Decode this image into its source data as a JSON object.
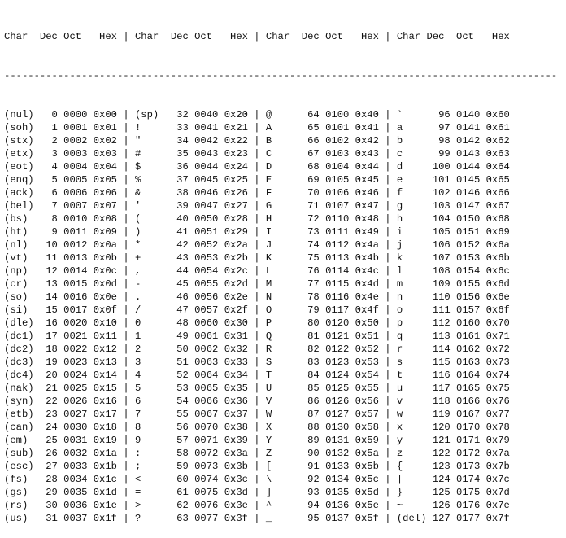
{
  "header": {
    "columns": [
      "Char",
      "Dec",
      "Oct",
      "Hex"
    ],
    "separator": "|",
    "rule": "---------------------------------------------------------------------------------------------"
  },
  "rows": [
    [
      "(nul)",
      "0",
      "0000",
      "0x00",
      "(sp)",
      "32",
      "0040",
      "0x20",
      "@",
      "64",
      "0100",
      "0x40",
      "`",
      "96",
      "0140",
      "0x60"
    ],
    [
      "(soh)",
      "1",
      "0001",
      "0x01",
      "!",
      "33",
      "0041",
      "0x21",
      "A",
      "65",
      "0101",
      "0x41",
      "a",
      "97",
      "0141",
      "0x61"
    ],
    [
      "(stx)",
      "2",
      "0002",
      "0x02",
      "\"",
      "34",
      "0042",
      "0x22",
      "B",
      "66",
      "0102",
      "0x42",
      "b",
      "98",
      "0142",
      "0x62"
    ],
    [
      "(etx)",
      "3",
      "0003",
      "0x03",
      "#",
      "35",
      "0043",
      "0x23",
      "C",
      "67",
      "0103",
      "0x43",
      "c",
      "99",
      "0143",
      "0x63"
    ],
    [
      "(eot)",
      "4",
      "0004",
      "0x04",
      "$",
      "36",
      "0044",
      "0x24",
      "D",
      "68",
      "0104",
      "0x44",
      "d",
      "100",
      "0144",
      "0x64"
    ],
    [
      "(enq)",
      "5",
      "0005",
      "0x05",
      "%",
      "37",
      "0045",
      "0x25",
      "E",
      "69",
      "0105",
      "0x45",
      "e",
      "101",
      "0145",
      "0x65"
    ],
    [
      "(ack)",
      "6",
      "0006",
      "0x06",
      "&",
      "38",
      "0046",
      "0x26",
      "F",
      "70",
      "0106",
      "0x46",
      "f",
      "102",
      "0146",
      "0x66"
    ],
    [
      "(bel)",
      "7",
      "0007",
      "0x07",
      "'",
      "39",
      "0047",
      "0x27",
      "G",
      "71",
      "0107",
      "0x47",
      "g",
      "103",
      "0147",
      "0x67"
    ],
    [
      "(bs)",
      "8",
      "0010",
      "0x08",
      "(",
      "40",
      "0050",
      "0x28",
      "H",
      "72",
      "0110",
      "0x48",
      "h",
      "104",
      "0150",
      "0x68"
    ],
    [
      "(ht)",
      "9",
      "0011",
      "0x09",
      ")",
      "41",
      "0051",
      "0x29",
      "I",
      "73",
      "0111",
      "0x49",
      "i",
      "105",
      "0151",
      "0x69"
    ],
    [
      "(nl)",
      "10",
      "0012",
      "0x0a",
      "*",
      "42",
      "0052",
      "0x2a",
      "J",
      "74",
      "0112",
      "0x4a",
      "j",
      "106",
      "0152",
      "0x6a"
    ],
    [
      "(vt)",
      "11",
      "0013",
      "0x0b",
      "+",
      "43",
      "0053",
      "0x2b",
      "K",
      "75",
      "0113",
      "0x4b",
      "k",
      "107",
      "0153",
      "0x6b"
    ],
    [
      "(np)",
      "12",
      "0014",
      "0x0c",
      ",",
      "44",
      "0054",
      "0x2c",
      "L",
      "76",
      "0114",
      "0x4c",
      "l",
      "108",
      "0154",
      "0x6c"
    ],
    [
      "(cr)",
      "13",
      "0015",
      "0x0d",
      "-",
      "45",
      "0055",
      "0x2d",
      "M",
      "77",
      "0115",
      "0x4d",
      "m",
      "109",
      "0155",
      "0x6d"
    ],
    [
      "(so)",
      "14",
      "0016",
      "0x0e",
      ".",
      "46",
      "0056",
      "0x2e",
      "N",
      "78",
      "0116",
      "0x4e",
      "n",
      "110",
      "0156",
      "0x6e"
    ],
    [
      "(si)",
      "15",
      "0017",
      "0x0f",
      "/",
      "47",
      "0057",
      "0x2f",
      "O",
      "79",
      "0117",
      "0x4f",
      "o",
      "111",
      "0157",
      "0x6f"
    ],
    [
      "(dle)",
      "16",
      "0020",
      "0x10",
      "0",
      "48",
      "0060",
      "0x30",
      "P",
      "80",
      "0120",
      "0x50",
      "p",
      "112",
      "0160",
      "0x70"
    ],
    [
      "(dc1)",
      "17",
      "0021",
      "0x11",
      "1",
      "49",
      "0061",
      "0x31",
      "Q",
      "81",
      "0121",
      "0x51",
      "q",
      "113",
      "0161",
      "0x71"
    ],
    [
      "(dc2)",
      "18",
      "0022",
      "0x12",
      "2",
      "50",
      "0062",
      "0x32",
      "R",
      "82",
      "0122",
      "0x52",
      "r",
      "114",
      "0162",
      "0x72"
    ],
    [
      "(dc3)",
      "19",
      "0023",
      "0x13",
      "3",
      "51",
      "0063",
      "0x33",
      "S",
      "83",
      "0123",
      "0x53",
      "s",
      "115",
      "0163",
      "0x73"
    ],
    [
      "(dc4)",
      "20",
      "0024",
      "0x14",
      "4",
      "52",
      "0064",
      "0x34",
      "T",
      "84",
      "0124",
      "0x54",
      "t",
      "116",
      "0164",
      "0x74"
    ],
    [
      "(nak)",
      "21",
      "0025",
      "0x15",
      "5",
      "53",
      "0065",
      "0x35",
      "U",
      "85",
      "0125",
      "0x55",
      "u",
      "117",
      "0165",
      "0x75"
    ],
    [
      "(syn)",
      "22",
      "0026",
      "0x16",
      "6",
      "54",
      "0066",
      "0x36",
      "V",
      "86",
      "0126",
      "0x56",
      "v",
      "118",
      "0166",
      "0x76"
    ],
    [
      "(etb)",
      "23",
      "0027",
      "0x17",
      "7",
      "55",
      "0067",
      "0x37",
      "W",
      "87",
      "0127",
      "0x57",
      "w",
      "119",
      "0167",
      "0x77"
    ],
    [
      "(can)",
      "24",
      "0030",
      "0x18",
      "8",
      "56",
      "0070",
      "0x38",
      "X",
      "88",
      "0130",
      "0x58",
      "x",
      "120",
      "0170",
      "0x78"
    ],
    [
      "(em)",
      "25",
      "0031",
      "0x19",
      "9",
      "57",
      "0071",
      "0x39",
      "Y",
      "89",
      "0131",
      "0x59",
      "y",
      "121",
      "0171",
      "0x79"
    ],
    [
      "(sub)",
      "26",
      "0032",
      "0x1a",
      ":",
      "58",
      "0072",
      "0x3a",
      "Z",
      "90",
      "0132",
      "0x5a",
      "z",
      "122",
      "0172",
      "0x7a"
    ],
    [
      "(esc)",
      "27",
      "0033",
      "0x1b",
      ";",
      "59",
      "0073",
      "0x3b",
      "[",
      "91",
      "0133",
      "0x5b",
      "{",
      "123",
      "0173",
      "0x7b"
    ],
    [
      "(fs)",
      "28",
      "0034",
      "0x1c",
      "<",
      "60",
      "0074",
      "0x3c",
      "\\",
      "92",
      "0134",
      "0x5c",
      "|",
      "124",
      "0174",
      "0x7c"
    ],
    [
      "(gs)",
      "29",
      "0035",
      "0x1d",
      "=",
      "61",
      "0075",
      "0x3d",
      "]",
      "93",
      "0135",
      "0x5d",
      "}",
      "125",
      "0175",
      "0x7d"
    ],
    [
      "(rs)",
      "30",
      "0036",
      "0x1e",
      ">",
      "62",
      "0076",
      "0x3e",
      "^",
      "94",
      "0136",
      "0x5e",
      "~",
      "126",
      "0176",
      "0x7e"
    ],
    [
      "(us)",
      "31",
      "0037",
      "0x1f",
      "?",
      "63",
      "0077",
      "0x3f",
      "_",
      "95",
      "0137",
      "0x5f",
      "(del)",
      "127",
      "0177",
      "0x7f"
    ]
  ]
}
